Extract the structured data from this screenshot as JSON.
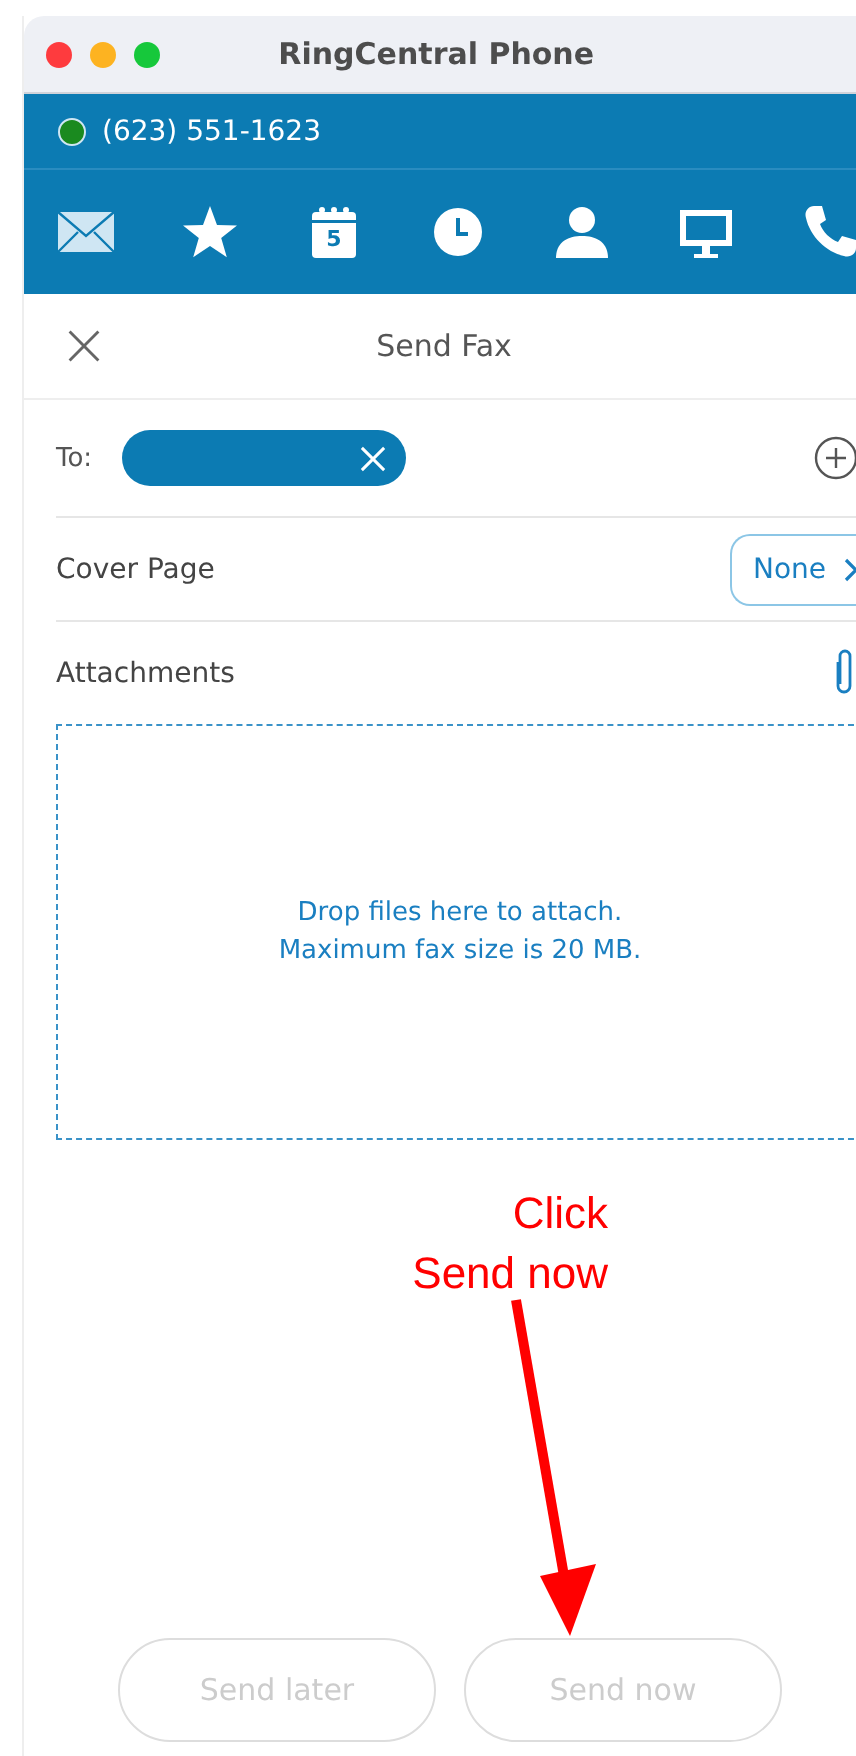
{
  "window": {
    "title": "RingCentral Phone"
  },
  "account": {
    "phone": "(623) 551-1623",
    "available": true
  },
  "nav": [
    {
      "kind": "mail",
      "selected": true
    },
    {
      "kind": "star",
      "selected": false
    },
    {
      "kind": "calendar",
      "label": "5",
      "selected": false
    },
    {
      "kind": "clock",
      "selected": false
    },
    {
      "kind": "person",
      "selected": false
    },
    {
      "kind": "monitor",
      "selected": false
    },
    {
      "kind": "phone",
      "selected": false
    }
  ],
  "header": {
    "title": "Send Fax"
  },
  "to": {
    "label": "To:"
  },
  "cover_page": {
    "label": "Cover Page",
    "value": "None"
  },
  "attachments": {
    "label": "Attachments",
    "drop_text": [
      "Drop files here to attach.",
      "Maximum fax size is 20 MB."
    ]
  },
  "annotation": {
    "lines": [
      "Click",
      "Send now"
    ]
  },
  "buttons": [
    {
      "label": "Send later",
      "disabled": true
    },
    {
      "label": "Send now",
      "disabled": true
    }
  ]
}
